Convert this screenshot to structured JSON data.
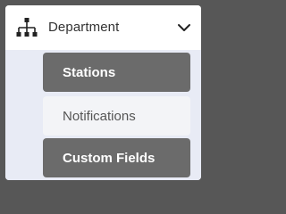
{
  "menu": {
    "header": {
      "icon": "department-hierarchy-icon",
      "label": "Department",
      "chevron": "chevron-down-icon"
    },
    "items": [
      {
        "label": "Stations",
        "style": "highlighted"
      },
      {
        "label": "Notifications",
        "style": "normal"
      },
      {
        "label": "Custom Fields",
        "style": "highlighted"
      }
    ]
  },
  "colors": {
    "background": "#575757",
    "panel": "#ffffff",
    "submenu_bg": "#e8ebf5",
    "highlighted_item": "#6b6b6b",
    "normal_item": "#f3f4f7"
  }
}
